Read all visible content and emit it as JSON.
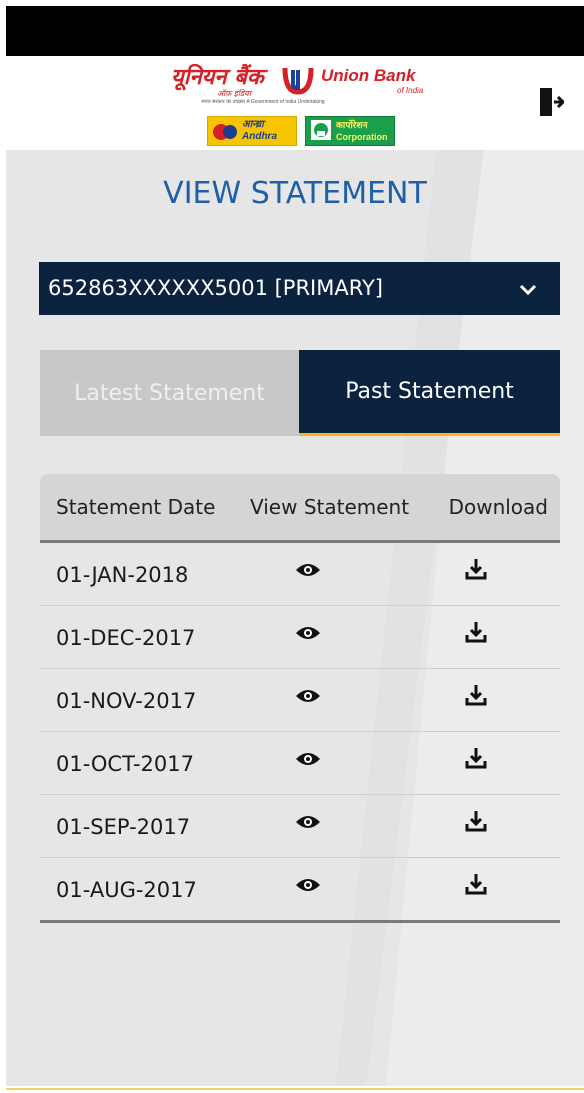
{
  "header": {
    "logo_hindi": "यूनियन बैंक",
    "logo_hindi_sub": "ऑफ़ इंडिया",
    "logo_english": "Union Bank",
    "logo_english_sub": "of India",
    "logo_tagline": "भारत सरकार का उपक्रम    A Government of India Undertaking",
    "andhra_line1": "आन्ध्रा",
    "andhra_line2": "Andhra",
    "corp_line1": "कार्पोरेशन",
    "corp_line2": "Corporation",
    "logout_icon": "logout-icon"
  },
  "page": {
    "title": "VIEW STATEMENT"
  },
  "account": {
    "selected": "652863XXXXXX5001 [PRIMARY]"
  },
  "tabs": [
    {
      "label": "Latest Statement",
      "active": false
    },
    {
      "label": "Past Statement",
      "active": true
    }
  ],
  "table": {
    "headers": [
      "Statement Date",
      "View Statement",
      "Download"
    ],
    "rows": [
      {
        "date": "01-JAN-2018"
      },
      {
        "date": "01-DEC-2017"
      },
      {
        "date": "01-NOV-2017"
      },
      {
        "date": "01-OCT-2017"
      },
      {
        "date": "01-SEP-2017"
      },
      {
        "date": "01-AUG-2017"
      }
    ]
  },
  "colors": {
    "brand_red": "#d71f26",
    "title_blue": "#1f5fa8",
    "navy": "#0c2340",
    "accent_yellow": "#f3b81c"
  }
}
